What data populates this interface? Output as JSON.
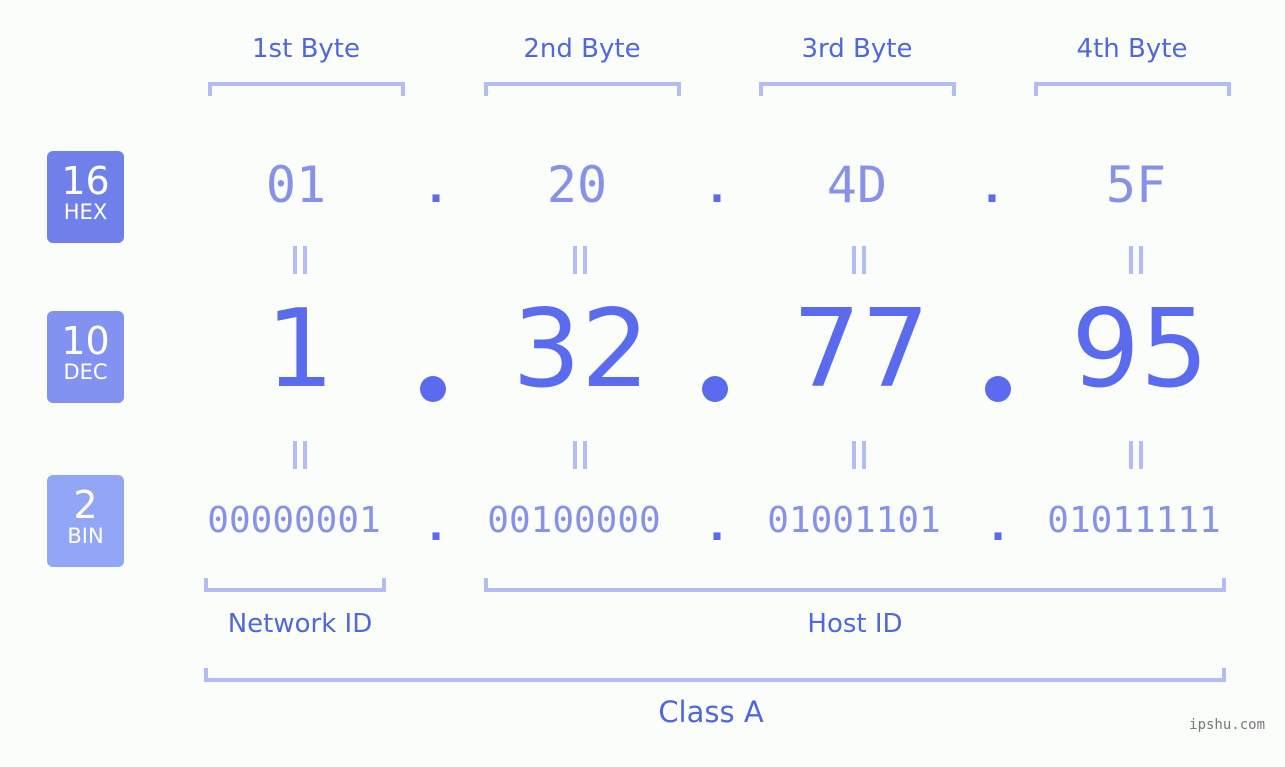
{
  "bytes": [
    {
      "label": "1st Byte",
      "hex": "01",
      "dec": "1",
      "bin": "00000001"
    },
    {
      "label": "2nd Byte",
      "hex": "20",
      "dec": "32",
      "bin": "00100000"
    },
    {
      "label": "3rd Byte",
      "hex": "4D",
      "dec": "77",
      "bin": "01001101"
    },
    {
      "label": "4th Byte",
      "hex": "5F",
      "dec": "95",
      "bin": "01011111"
    }
  ],
  "badges": {
    "hex": {
      "num": "16",
      "label": "HEX",
      "color": "#6f80ea"
    },
    "dec": {
      "num": "10",
      "label": "DEC",
      "color": "#8292f0"
    },
    "bin": {
      "num": "2",
      "label": "BIN",
      "color": "#91a7f6"
    }
  },
  "separator": ".",
  "network_id_label": "Network ID",
  "host_id_label": "Host ID",
  "class_label": "Class A",
  "watermark": "ipshu.com"
}
